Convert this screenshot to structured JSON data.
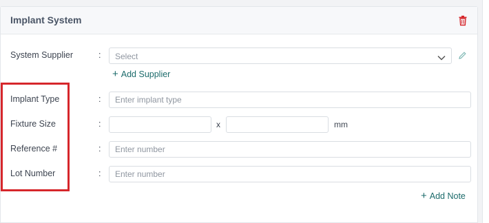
{
  "section": {
    "title": "Implant System"
  },
  "supplier": {
    "label": "System Supplier",
    "colon": ":",
    "select_value": "Select",
    "add_label": "Add Supplier"
  },
  "implant_type": {
    "label": "Implant Type",
    "colon": ":",
    "placeholder": "Enter implant type"
  },
  "fixture_size": {
    "label": "Fixture Size",
    "colon": ":",
    "separator": "x",
    "unit": "mm"
  },
  "reference": {
    "label": "Reference #",
    "colon": ":",
    "placeholder": "Enter number"
  },
  "lot_number": {
    "label": "Lot Number",
    "colon": ":",
    "placeholder": "Enter number"
  },
  "note": {
    "add_label": "Add Note"
  },
  "icons": {
    "delete": "trash-icon",
    "edit": "pencil-icon",
    "dropdown": "chevron-down-icon",
    "add": "plus-icon"
  },
  "colors": {
    "accent": "#1c6b6b",
    "danger": "#d6262b",
    "highlight": "#d6262b"
  }
}
